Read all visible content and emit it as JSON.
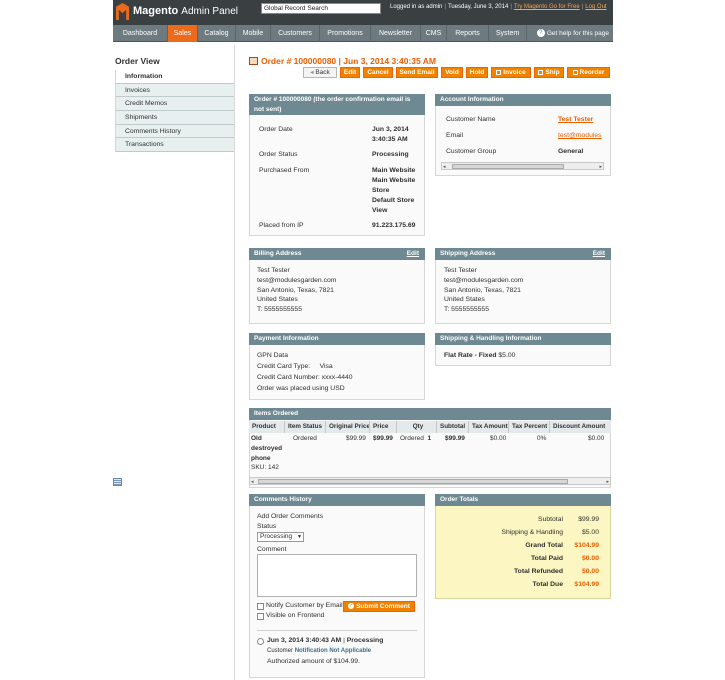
{
  "header": {
    "logo_brand": "Magento",
    "logo_sub": "Admin Panel",
    "search_value": "Global Record Search",
    "logged_in": "Logged in as admin",
    "date": "Tuesday, June 3, 2014",
    "try_link": "Try Magento Go for Free",
    "logout": "Log Out"
  },
  "nav": {
    "items": [
      "Dashboard",
      "Sales",
      "Catalog",
      "Mobile",
      "Customers",
      "Promotions",
      "Newsletter",
      "CMS",
      "Reports",
      "System"
    ],
    "help": "Get help for this page"
  },
  "sidebar": {
    "title": "Order View",
    "items": [
      "Information",
      "Invoices",
      "Credit Memos",
      "Shipments",
      "Comments History",
      "Transactions"
    ]
  },
  "page": {
    "title": "Order # 100000080 | Jun 3, 2014 3:40:35 AM",
    "buttons": [
      "Back",
      "Edit",
      "Cancel",
      "Send Email",
      "Void",
      "Hold",
      "Invoice",
      "Ship",
      "Reorder"
    ]
  },
  "order": {
    "head_line1": "Order # 100000080 (the order confirmation email is",
    "head_line2": "not sent)",
    "date_label": "Order Date",
    "date_value": [
      "Jun 3, 2014",
      "3:40:35 AM"
    ],
    "status_label": "Order Status",
    "status_value": "Processing",
    "purchased_label": "Purchased From",
    "purchased_value": [
      "Main Website",
      "Main Website",
      "Store",
      "Default Store",
      "View"
    ],
    "ip_label": "Placed from IP",
    "ip_value": "91.223.175.69"
  },
  "account": {
    "head": "Account Information",
    "name_label": "Customer Name",
    "name_value": "Test Tester",
    "email_label": "Email",
    "email_value": "test@modules",
    "group_label": "Customer Group",
    "group_value": "General"
  },
  "billing": {
    "head": "Billing Address",
    "edit": "Edit",
    "lines": [
      "Test Tester",
      "test@modulesgarden.com",
      "San Antonio, Texas, 7821",
      "United States",
      "T: 5555555555"
    ]
  },
  "shipping_address": {
    "head": "Shipping Address",
    "edit": "Edit",
    "lines": [
      "Test Tester",
      "test@modulesgarden.com",
      "San Antonio, Texas, 7821",
      "United States",
      "T: 5555555555"
    ]
  },
  "payment": {
    "head": "Payment Information",
    "method": "GPN Data",
    "type_label": "Credit Card Type:",
    "type_value": "Visa",
    "number_label": "Credit Card Number:",
    "number_value": "xxxx-4440",
    "currency": "Order was placed using USD"
  },
  "shipping_method": {
    "head": "Shipping & Handling Information",
    "method": "Flat Rate - Fixed",
    "amount": "$5.00"
  },
  "items": {
    "head": "Items Ordered",
    "columns": [
      "Product",
      "Item Status",
      "Original Price",
      "Price",
      "Qty",
      "Subtotal",
      "Tax Amount",
      "Tax Percent",
      "Discount Amount"
    ],
    "row": {
      "product": [
        "Old",
        "destroyed",
        "phone"
      ],
      "sku": "SKU: 142",
      "status": "Ordered",
      "original_price": "$99.99",
      "price": "$99.99",
      "qty_label": "Ordered",
      "qty": "1",
      "subtotal": "$99.99",
      "tax_amount": "$0.00",
      "tax_percent": "0%",
      "discount": "$0.00"
    }
  },
  "comments": {
    "head": "Comments History",
    "add_label": "Add Order Comments",
    "status_label": "Status",
    "status_value": "Processing",
    "comment_label": "Comment",
    "notify_label": "Notify Customer by Email",
    "visible_label": "Visible on Frontend",
    "submit": "Submit Comment",
    "entry_date": "Jun 3, 2014 3:40:43 AM",
    "entry_sep": "|",
    "entry_status": "Processing",
    "entry_customer": "Customer",
    "entry_notification": "Notification Not Applicable",
    "entry_text": "Authorized amount of $104.99."
  },
  "totals": {
    "head": "Order Totals",
    "rows": [
      {
        "label": "Subtotal",
        "value": "$99.99"
      },
      {
        "label": "Shipping & Handling",
        "value": "$5.00"
      },
      {
        "label": "Grand Total",
        "value": "$104.99"
      },
      {
        "label": "Total Paid",
        "value": "$0.00"
      },
      {
        "label": "Total Refunded",
        "value": "$0.00"
      },
      {
        "label": "Total Due",
        "value": "$104.99"
      }
    ]
  },
  "colors": {
    "accent": "#eb5e00",
    "nav_bg": "#6d7a7f",
    "header_bg": "#3a3f42",
    "panel_head": "#6f8992",
    "totals_bg": "#fbf6c2"
  }
}
